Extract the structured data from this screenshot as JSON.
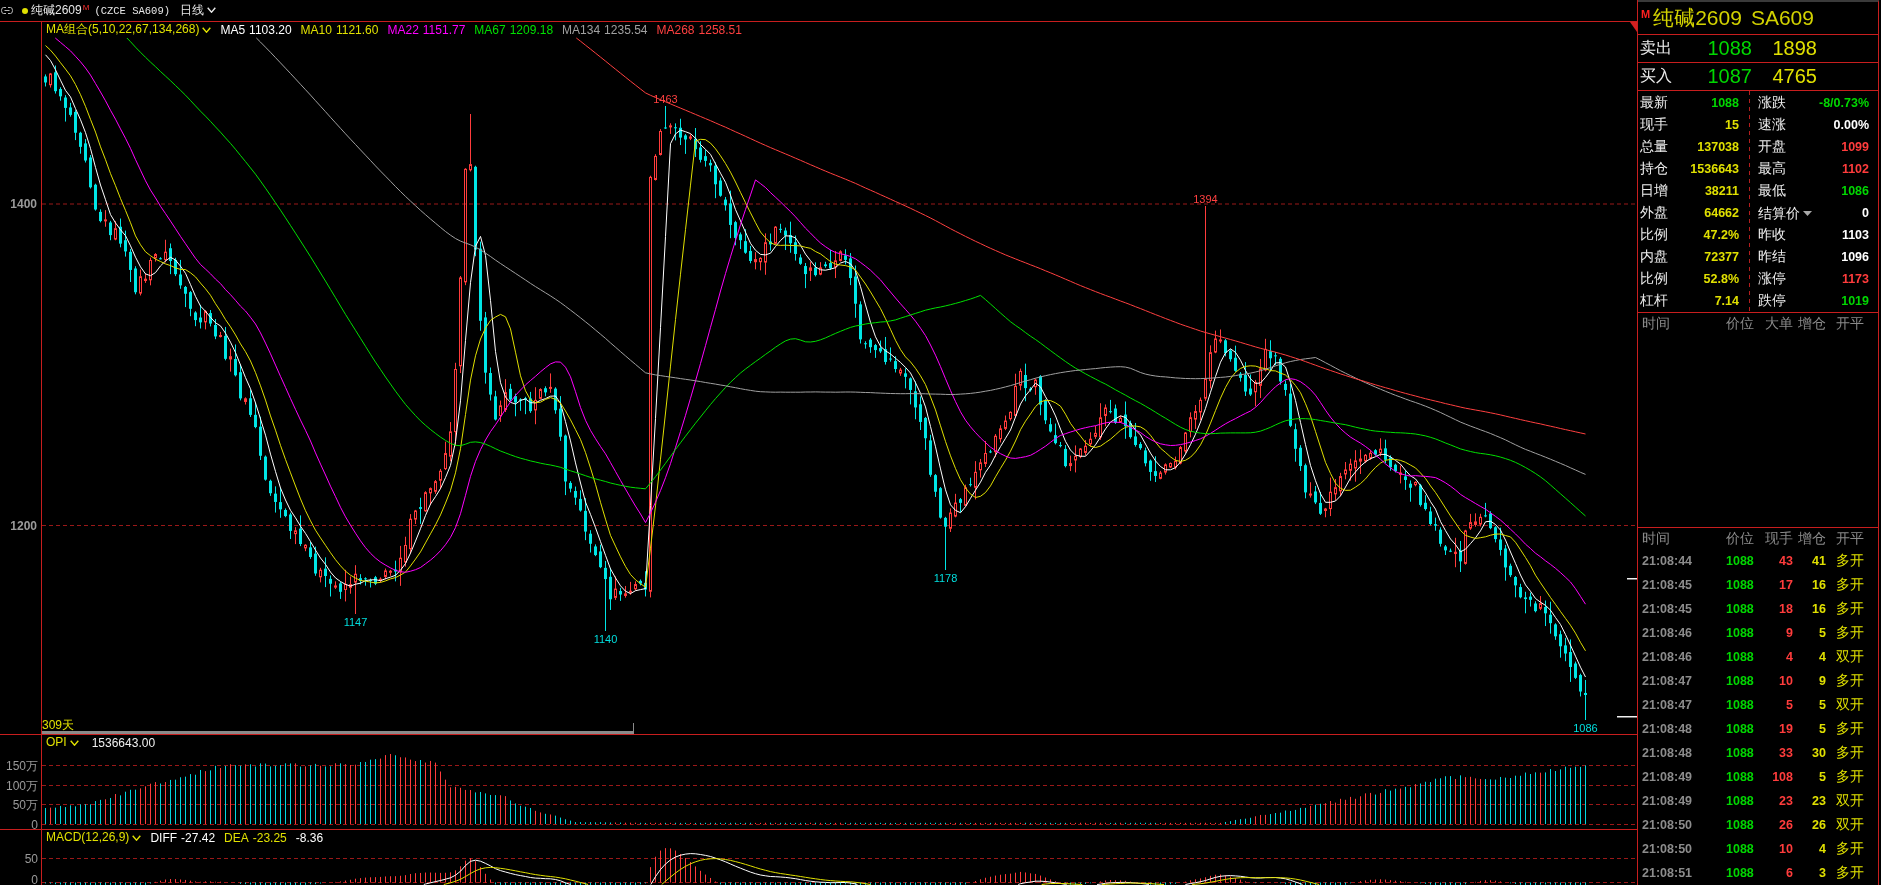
{
  "header": {
    "symbol": "纯碱2609",
    "flag": "M",
    "exchange_code": "(CZCE SA609)",
    "period": "日线"
  },
  "main_chart": {
    "indicator": "MA组合(5,10,22,67,134,268)",
    "ma_lines": [
      {
        "name": "MA5",
        "value": "1103.20",
        "color": "#ffffff"
      },
      {
        "name": "MA10",
        "value": "1121.60",
        "color": "#e0e000"
      },
      {
        "name": "MA22",
        "value": "1151.77",
        "color": "#ff00ff"
      },
      {
        "name": "MA67",
        "value": "1209.18",
        "color": "#00e000"
      },
      {
        "name": "MA134",
        "value": "1235.54",
        "color": "#a0a0a0"
      },
      {
        "name": "MA268",
        "value": "1258.51",
        "color": "#ff4040"
      }
    ],
    "y_axis": [
      "1400",
      "1200"
    ],
    "markers": [
      {
        "label": "1463",
        "kind": "high"
      },
      {
        "label": "1394",
        "kind": "high"
      },
      {
        "label": "1178",
        "kind": "low"
      },
      {
        "label": "1147",
        "kind": "low"
      },
      {
        "label": "1140",
        "kind": "low"
      },
      {
        "label": "1086",
        "kind": "low"
      }
    ],
    "range_label": "309天"
  },
  "opi_panel": {
    "indicator": "OPI",
    "value": "1536643.00",
    "y_axis": [
      "150万",
      "100万",
      "50万",
      "0"
    ]
  },
  "macd_panel": {
    "indicator": "MACD(12,26,9)",
    "values": [
      {
        "name": "DIFF",
        "value": "-27.42",
        "color": "#ffffff"
      },
      {
        "name": "DEA",
        "value": "-23.25",
        "color": "#e0e000"
      },
      {
        "value": "-8.36",
        "color": "#ffffff"
      }
    ],
    "y_axis": [
      "50",
      "0"
    ]
  },
  "quote": {
    "badge": "M",
    "name": "纯碱2609",
    "code": "SA609",
    "book": [
      {
        "label": "卖出",
        "price": "1088",
        "volume": "1898"
      },
      {
        "label": "买入",
        "price": "1087",
        "volume": "4765"
      }
    ],
    "stats": [
      {
        "label": "最新",
        "value": "1088",
        "color": "#00d700",
        "kind": "plain"
      },
      {
        "label": "涨跌",
        "value": "-8/0.73%",
        "color": "#00d700",
        "kind": "plain"
      },
      {
        "label": "现手",
        "value": "15",
        "color": "#e0e000",
        "kind": "plain"
      },
      {
        "label": "速涨",
        "value": "0.00%",
        "color": "#ffffff",
        "kind": "plain"
      },
      {
        "label": "总量",
        "value": "137038",
        "color": "#e0e000",
        "kind": "plain"
      },
      {
        "label": "开盘",
        "value": "1099",
        "color": "#ff3c3c",
        "kind": "plain"
      },
      {
        "label": "持仓",
        "value": "1536643",
        "color": "#e0e000",
        "kind": "plain"
      },
      {
        "label": "最高",
        "value": "1102",
        "color": "#ff3c3c",
        "kind": "plain"
      },
      {
        "label": "日增",
        "value": "38211",
        "color": "#e0e000",
        "kind": "plain"
      },
      {
        "label": "最低",
        "value": "1086",
        "color": "#00d700",
        "kind": "plain"
      },
      {
        "label": "外盘",
        "value": "64662",
        "color": "#e0e000",
        "kind": "plain"
      },
      {
        "label": "结算价",
        "value": "0",
        "color": "#ffffff",
        "kind": "dropdown"
      },
      {
        "label": "比例",
        "value": "47.2%",
        "color": "#e0e000",
        "kind": "plain"
      },
      {
        "label": "昨收",
        "value": "1103",
        "color": "#ffffff",
        "kind": "plain"
      },
      {
        "label": "内盘",
        "value": "72377",
        "color": "#e0e000",
        "kind": "plain"
      },
      {
        "label": "昨结",
        "value": "1096",
        "color": "#ffffff",
        "kind": "plain"
      },
      {
        "label": "比例",
        "value": "52.8%",
        "color": "#e0e000",
        "kind": "plain"
      },
      {
        "label": "涨停",
        "value": "1173",
        "color": "#ff3c3c",
        "kind": "plain"
      },
      {
        "label": "杠杆",
        "value": "7.14",
        "color": "#e0e000",
        "kind": "plain"
      },
      {
        "label": "跌停",
        "value": "1019",
        "color": "#00d700",
        "kind": "plain"
      }
    ]
  },
  "big_orders": {
    "columns": [
      "时间",
      "价位",
      "大单",
      "增仓",
      "开平"
    ]
  },
  "ticks": {
    "columns": [
      "时间",
      "价位",
      "现手",
      "增仓",
      "开平"
    ],
    "rows": [
      {
        "time": "21:08:44",
        "price": "1088",
        "volume": "43",
        "oi_change": "41",
        "action": "多开"
      },
      {
        "time": "21:08:45",
        "price": "1088",
        "volume": "17",
        "oi_change": "16",
        "action": "多开"
      },
      {
        "time": "21:08:45",
        "price": "1088",
        "volume": "18",
        "oi_change": "16",
        "action": "多开"
      },
      {
        "time": "21:08:46",
        "price": "1088",
        "volume": "9",
        "oi_change": "5",
        "action": "多开"
      },
      {
        "time": "21:08:46",
        "price": "1088",
        "volume": "4",
        "oi_change": "4",
        "action": "双开"
      },
      {
        "time": "21:08:47",
        "price": "1088",
        "volume": "10",
        "oi_change": "9",
        "action": "多开"
      },
      {
        "time": "21:08:47",
        "price": "1088",
        "volume": "5",
        "oi_change": "5",
        "action": "双开"
      },
      {
        "time": "21:08:48",
        "price": "1088",
        "volume": "19",
        "oi_change": "5",
        "action": "多开"
      },
      {
        "time": "21:08:48",
        "price": "1088",
        "volume": "33",
        "oi_change": "30",
        "action": "多开"
      },
      {
        "time": "21:08:49",
        "price": "1088",
        "volume": "108",
        "oi_change": "5",
        "action": "多开"
      },
      {
        "time": "21:08:49",
        "price": "1088",
        "volume": "23",
        "oi_change": "23",
        "action": "双开"
      },
      {
        "time": "21:08:50",
        "price": "1088",
        "volume": "26",
        "oi_change": "26",
        "action": "双开"
      },
      {
        "time": "21:08:50",
        "price": "1088",
        "volume": "10",
        "oi_change": "4",
        "action": "多开"
      },
      {
        "time": "21:08:51",
        "price": "1088",
        "volume": "6",
        "oi_change": "3",
        "action": "多开"
      }
    ]
  }
}
